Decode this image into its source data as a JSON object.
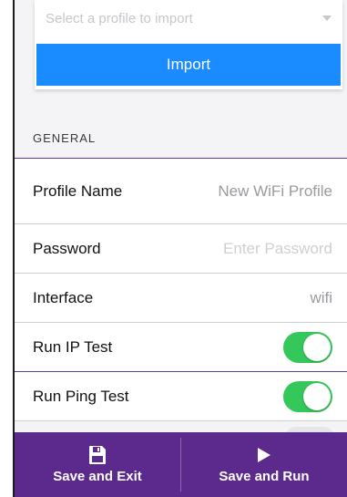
{
  "import": {
    "select_placeholder": "Select a profile to import",
    "button_label": "Import"
  },
  "general": {
    "header": "GENERAL",
    "rows": [
      {
        "label": "Profile Name",
        "value": "New WiFi Profile"
      },
      {
        "label": "Password",
        "placeholder": "Enter Password"
      },
      {
        "label": "Interface",
        "value": "wifi"
      },
      {
        "label": "Run IP Test",
        "enabled": true
      },
      {
        "label": "Run Ping Test",
        "enabled": true
      }
    ]
  },
  "bottom_bar": {
    "save_exit": {
      "label": "Save and Exit",
      "icon": "save-icon"
    },
    "save_run": {
      "label": "Save and Run",
      "icon": "play-icon"
    }
  },
  "colors": {
    "accent_blue": "#1a8cff",
    "purple": "#5b2a8c",
    "toggle_green": "#34c759"
  }
}
